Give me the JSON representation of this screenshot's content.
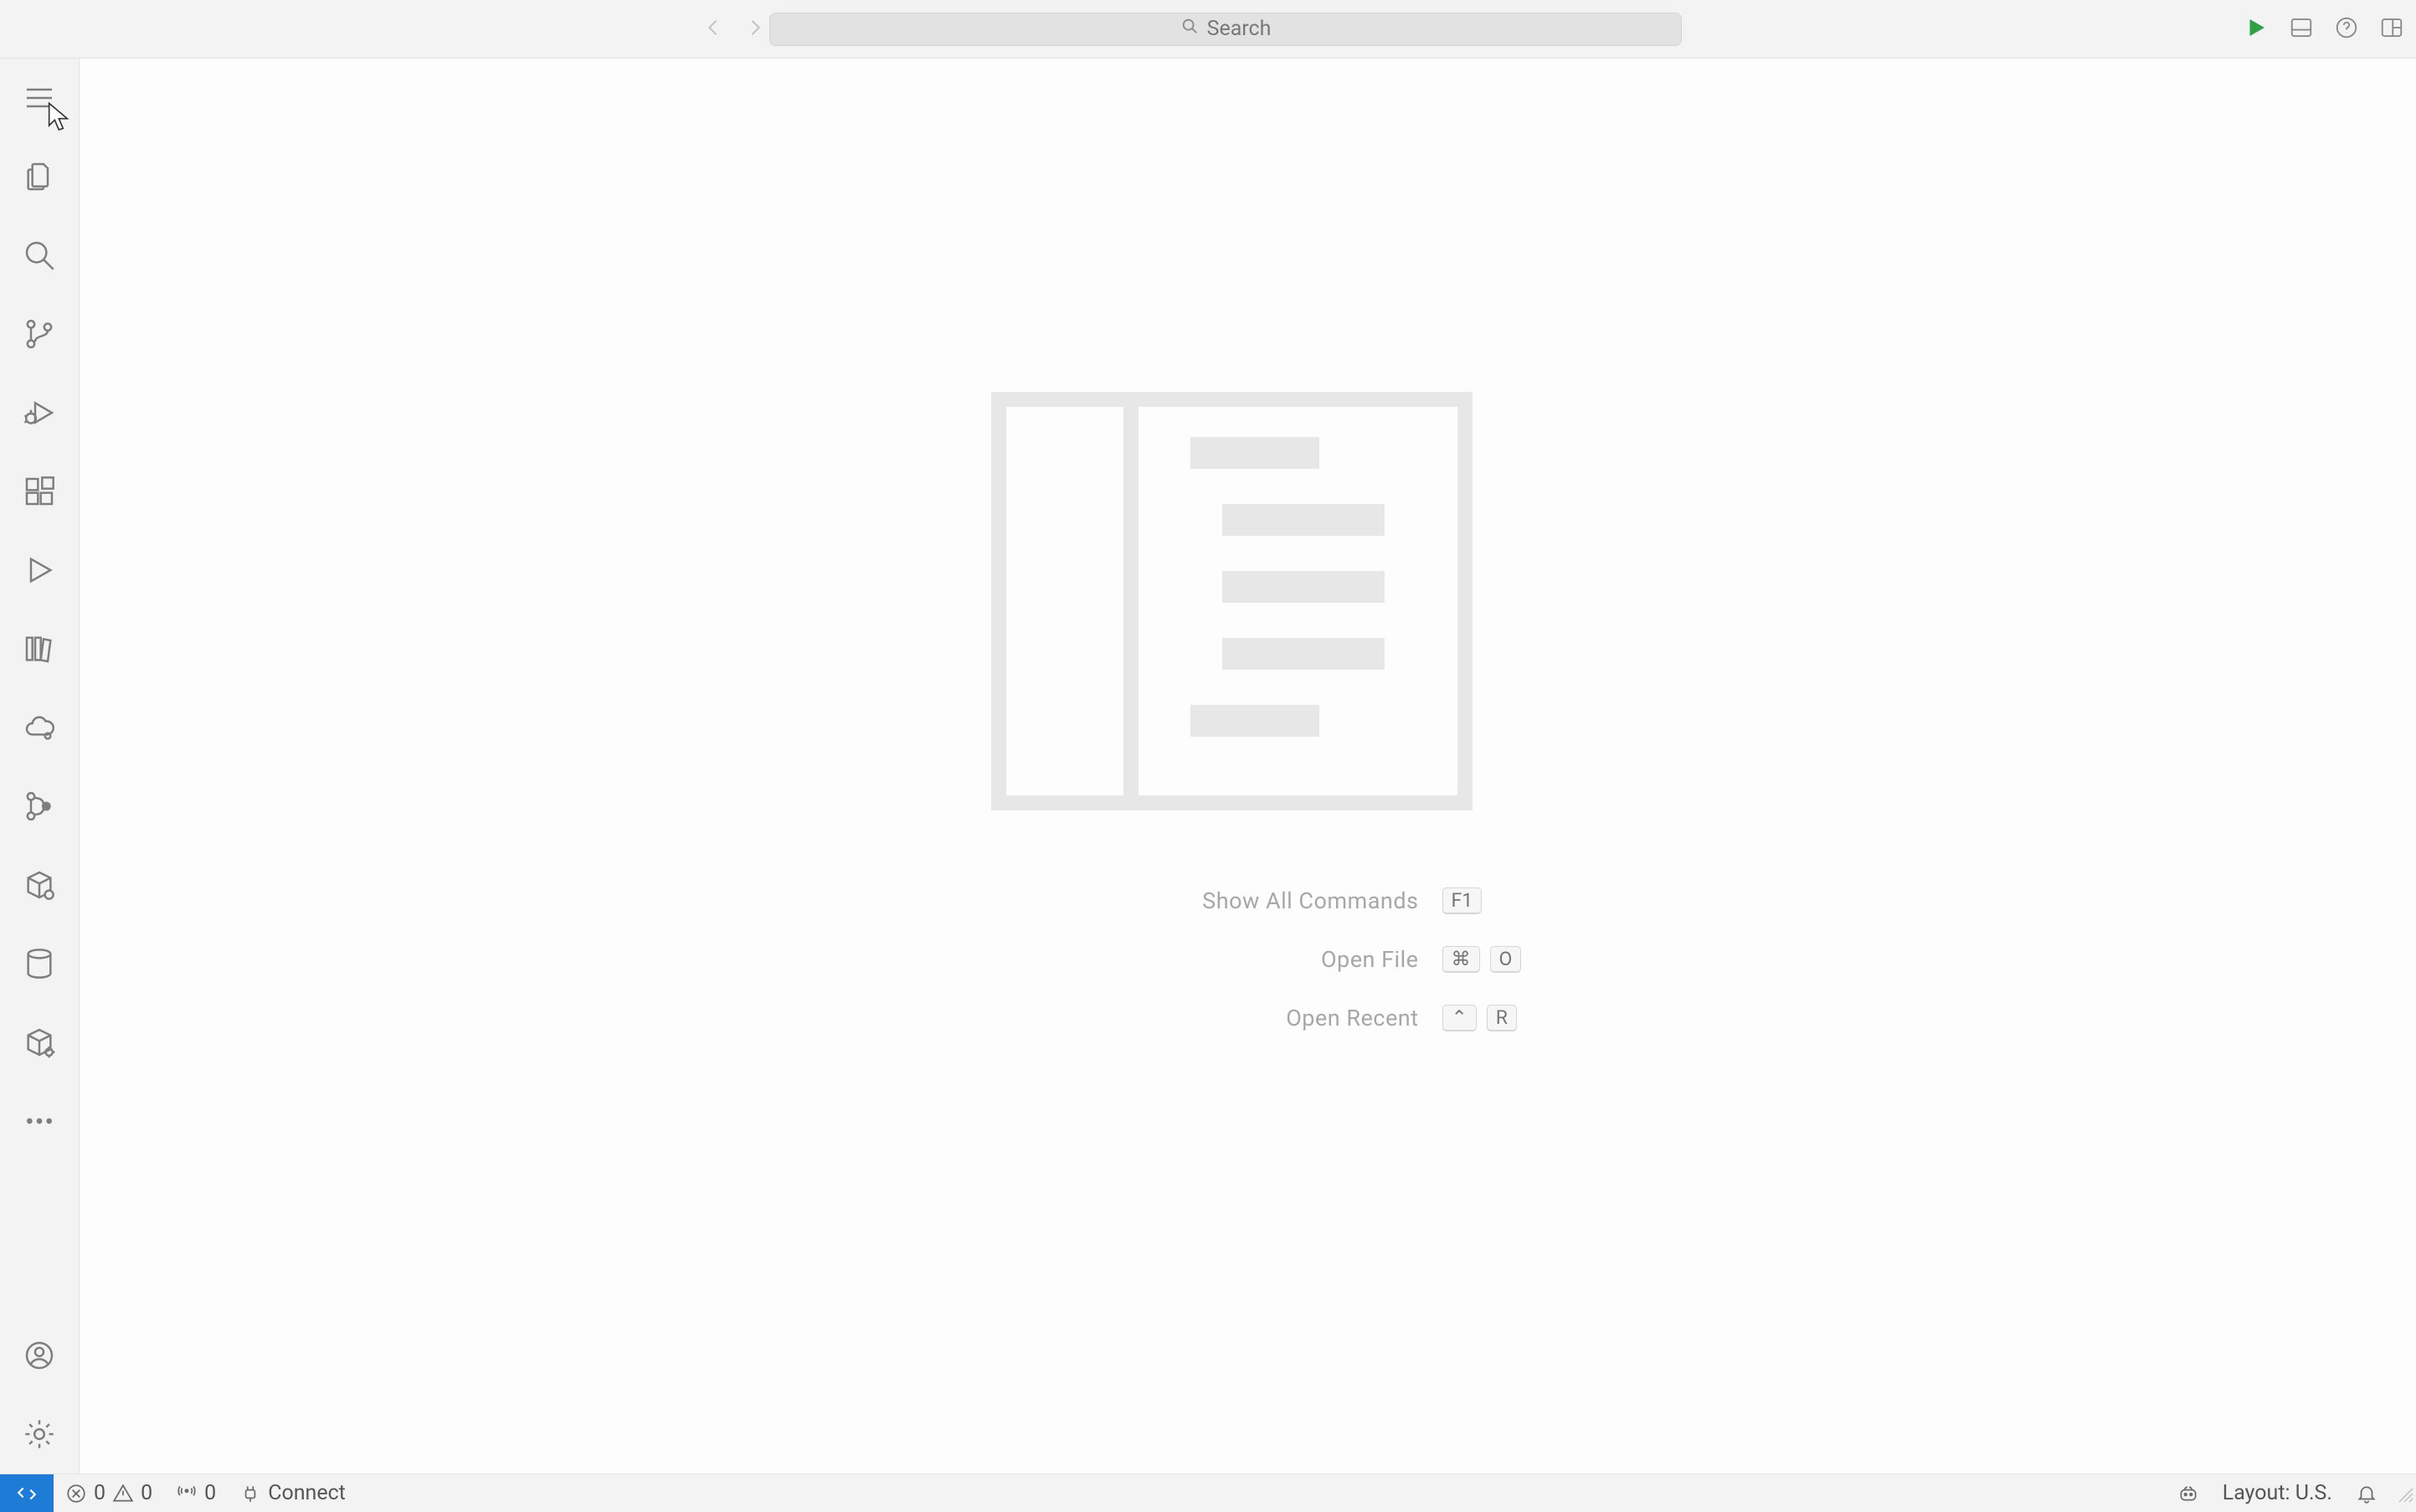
{
  "titlebar": {
    "search_placeholder": "Search"
  },
  "activity": {
    "items": [
      {
        "name": "menu"
      },
      {
        "name": "explorer"
      },
      {
        "name": "search"
      },
      {
        "name": "source-control"
      },
      {
        "name": "run-debug"
      },
      {
        "name": "extensions"
      },
      {
        "name": "play"
      },
      {
        "name": "library"
      },
      {
        "name": "cloud"
      },
      {
        "name": "graph"
      },
      {
        "name": "box-dot"
      },
      {
        "name": "database"
      },
      {
        "name": "cube"
      },
      {
        "name": "more"
      }
    ],
    "bottom": [
      {
        "name": "account"
      },
      {
        "name": "settings"
      }
    ]
  },
  "hints": [
    {
      "label": "Show All Commands",
      "keys": [
        "F1"
      ]
    },
    {
      "label": "Open File",
      "keys": [
        "⌘",
        "O"
      ]
    },
    {
      "label": "Open Recent",
      "keys": [
        "⌃",
        "R"
      ]
    }
  ],
  "statusbar": {
    "errors": "0",
    "warnings": "0",
    "ports": "0",
    "connect_label": "Connect",
    "layout_label": "Layout: U.S."
  }
}
